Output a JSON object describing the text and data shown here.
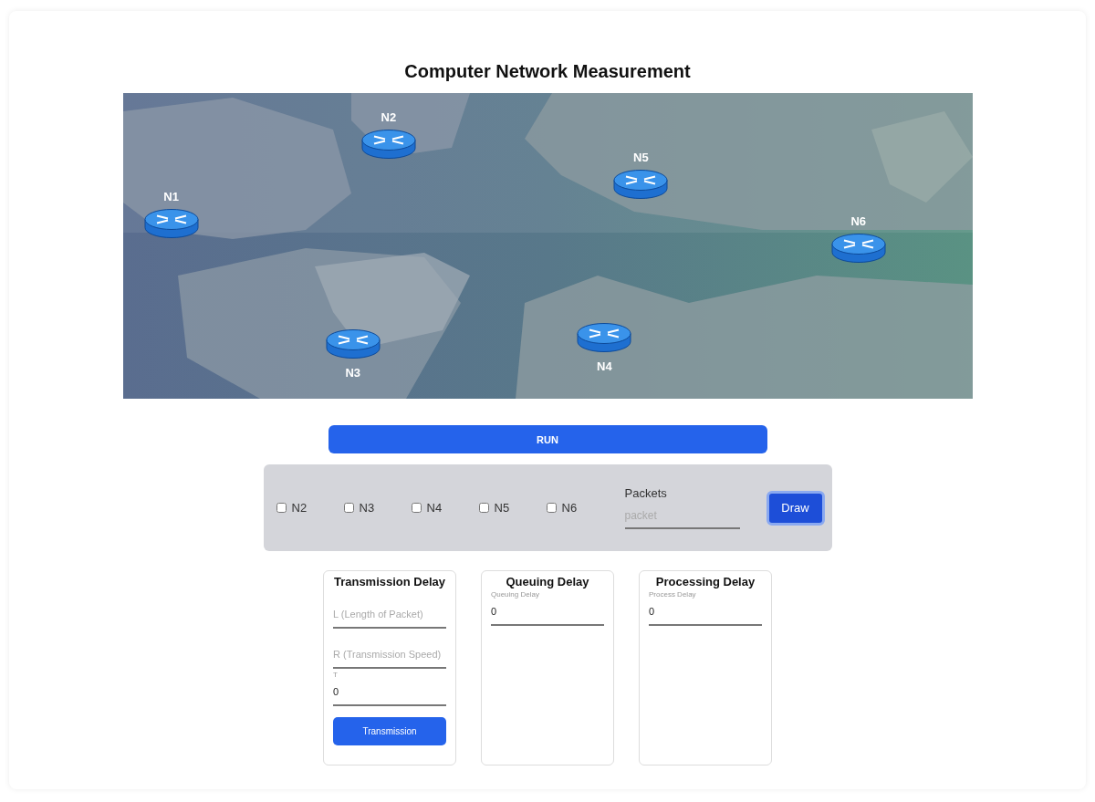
{
  "title": "Computer Network Measurement",
  "map": {
    "nodes": [
      {
        "label": "N1"
      },
      {
        "label": "N2"
      },
      {
        "label": "N3"
      },
      {
        "label": "N4"
      },
      {
        "label": "N5"
      },
      {
        "label": "N6"
      }
    ]
  },
  "run_button": "RUN",
  "controls": {
    "checkboxes": [
      {
        "label": "N2",
        "checked": false
      },
      {
        "label": "N3",
        "checked": false
      },
      {
        "label": "N4",
        "checked": false
      },
      {
        "label": "N5",
        "checked": false
      },
      {
        "label": "N6",
        "checked": false
      }
    ],
    "packets": {
      "label": "Packets",
      "placeholder": "packet"
    },
    "draw_button": "Draw"
  },
  "cards": [
    {
      "title": "Transmission Delay",
      "fields": [
        {
          "placeholder": "L (Length of Packet)"
        },
        {
          "placeholder": "R (Transmission Speed)"
        },
        {
          "label": "T",
          "value": "0"
        }
      ],
      "button": "Transmission"
    },
    {
      "title": "Queuing Delay",
      "fields": [
        {
          "label": "Queuing Delay",
          "value": "0"
        }
      ]
    },
    {
      "title": "Processing Delay",
      "fields": [
        {
          "label": "Process Delay",
          "value": "0"
        }
      ]
    }
  ]
}
